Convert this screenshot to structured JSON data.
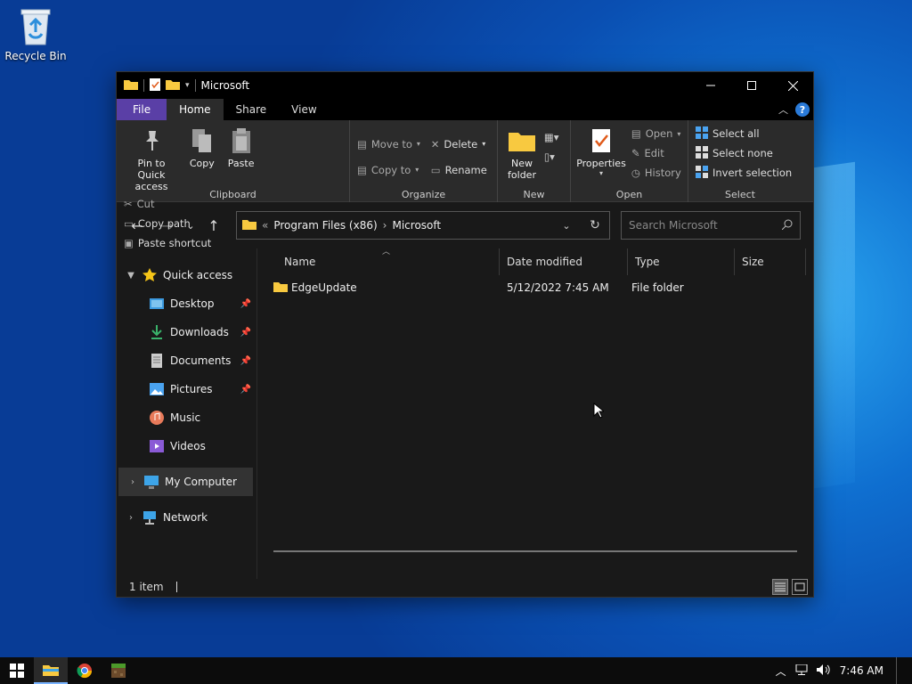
{
  "desktop": {
    "recycle_bin_label": "Recycle Bin"
  },
  "window": {
    "title": "Microsoft",
    "tabs": [
      {
        "label": "File"
      },
      {
        "label": "Home"
      },
      {
        "label": "Share"
      },
      {
        "label": "View"
      }
    ],
    "active_tab": "Home"
  },
  "ribbon": {
    "clipboard": {
      "pin_label": "Pin to Quick access",
      "copy_label": "Copy",
      "paste_label": "Paste",
      "cut_label": "Cut",
      "copy_path_label": "Copy path",
      "paste_shortcut_label": "Paste shortcut",
      "group_name": "Clipboard"
    },
    "organize": {
      "move_to_label": "Move to",
      "copy_to_label": "Copy to",
      "delete_label": "Delete",
      "rename_label": "Rename",
      "group_name": "Organize"
    },
    "new": {
      "new_folder_label": "New folder",
      "group_name": "New"
    },
    "open": {
      "properties_label": "Properties",
      "open_label": "Open",
      "edit_label": "Edit",
      "history_label": "History",
      "group_name": "Open"
    },
    "select": {
      "select_all_label": "Select all",
      "select_none_label": "Select none",
      "invert_selection_label": "Invert selection",
      "group_name": "Select"
    }
  },
  "address": {
    "overflow": "«",
    "crumbs": [
      "Program Files (x86)",
      "Microsoft"
    ],
    "separator": "›"
  },
  "search": {
    "placeholder": "Search Microsoft"
  },
  "nav": {
    "quick_access": "Quick access",
    "items": [
      {
        "label": "Desktop",
        "pinned": true
      },
      {
        "label": "Downloads",
        "pinned": true
      },
      {
        "label": "Documents",
        "pinned": true
      },
      {
        "label": "Pictures",
        "pinned": true
      },
      {
        "label": "Music",
        "pinned": false
      },
      {
        "label": "Videos",
        "pinned": false
      }
    ],
    "my_computer": "My Computer",
    "network": "Network"
  },
  "columns": {
    "name": "Name",
    "date": "Date modified",
    "type": "Type",
    "size": "Size"
  },
  "files": [
    {
      "name": "EdgeUpdate",
      "date": "5/12/2022 7:45 AM",
      "type": "File folder",
      "size": ""
    }
  ],
  "status": {
    "count": "1 item"
  },
  "taskbar": {
    "time": "7:46 AM"
  },
  "colors": {
    "file_tab": "#5a3fa6",
    "ribbon_bg": "#2b2b2b",
    "window_bg": "#191919",
    "folder": "#f8c940"
  }
}
